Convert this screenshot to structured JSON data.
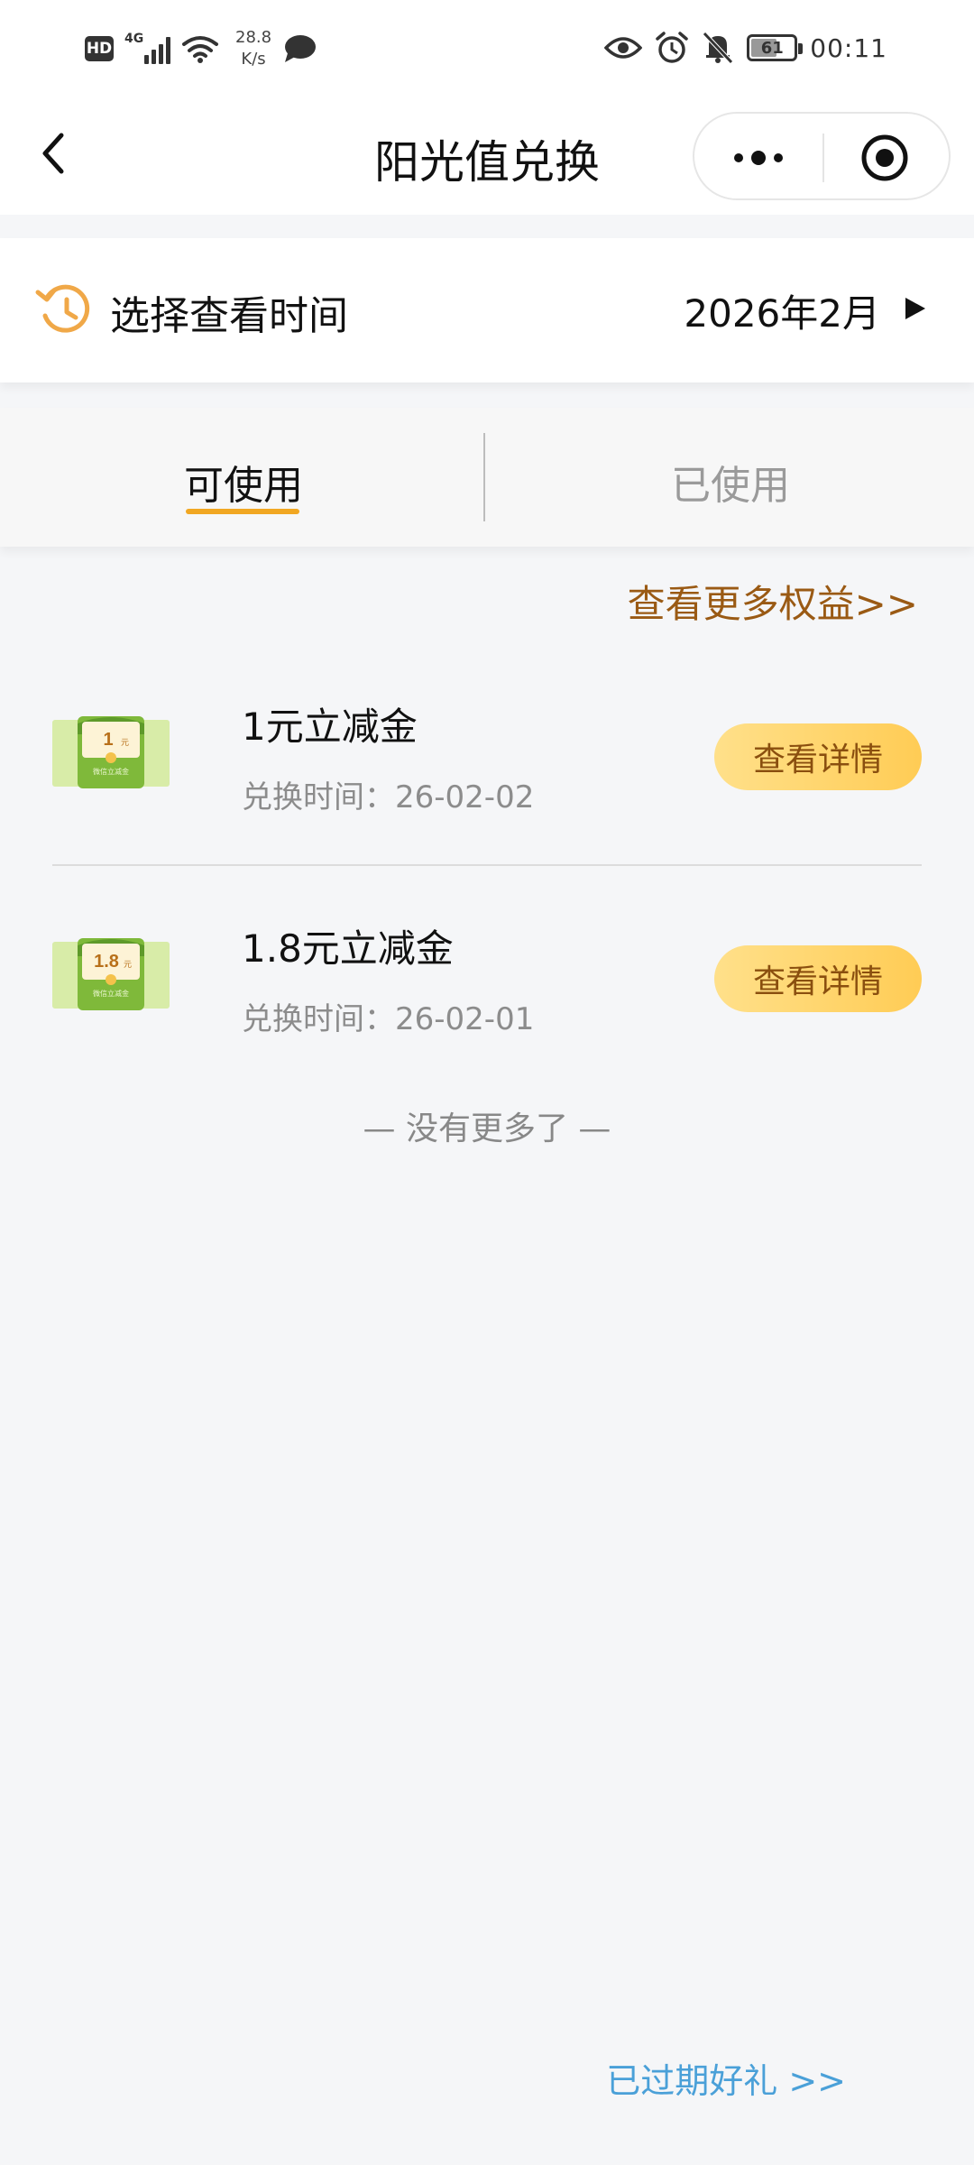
{
  "status_bar": {
    "hd": "HD",
    "network_type": "4G",
    "net_speed_value": "28.8",
    "net_speed_unit": "K/s",
    "battery_level": 61,
    "battery_text": "61",
    "clock": "00:11"
  },
  "nav": {
    "title": "阳光值兑换"
  },
  "time_picker": {
    "label": "选择查看时间",
    "selected_month": "2026年2月"
  },
  "tabs": [
    {
      "label": "可使用",
      "active": true
    },
    {
      "label": "已使用",
      "active": false
    }
  ],
  "more_benefits_link": "查看更多权益>>",
  "rewards": [
    {
      "name": "1元立减金",
      "time_label": "兑换时间：",
      "time_value": "26-02-02",
      "thumb_amount": "1",
      "thumb_unit": "元",
      "thumb_caption": "微信立减金",
      "button": "查看详情"
    },
    {
      "name": "1.8元立减金",
      "time_label": "兑换时间：",
      "time_value": "26-02-01",
      "thumb_amount": "1.8",
      "thumb_unit": "元",
      "thumb_caption": "微信立减金",
      "button": "查看详情"
    }
  ],
  "end_text": "— 没有更多了 —",
  "expired_link": "已过期好礼 >>",
  "colors": {
    "accent_orange": "#f1a722",
    "link_brown": "#9a5a14",
    "link_blue": "#4aa0d8",
    "button_gradient_start": "#ffe08a",
    "button_gradient_end": "#ffcc55"
  }
}
